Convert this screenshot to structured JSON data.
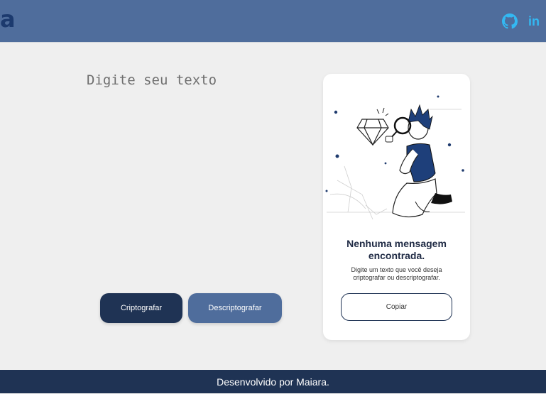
{
  "header": {
    "logo_text": "a",
    "github_icon": "github-icon",
    "linkedin_label": "in"
  },
  "main": {
    "input_placeholder": "Digite seu texto",
    "encrypt_label": "Criptografar",
    "decrypt_label": "Descriptografar"
  },
  "result_card": {
    "illustration": "person-inspecting-diamond",
    "title": "Nenhuma mensagem encontrada.",
    "subtitle": "Digite um texto que você deseja criptografar ou descriptografar.",
    "copy_label": "Copiar"
  },
  "footer": {
    "text": "Desenvolvido por Maiara."
  },
  "colors": {
    "header": "#4f6d9c",
    "primary": "#1f3354",
    "secondary": "#4f6d9c",
    "link": "#33b8f2",
    "background": "#efefef"
  }
}
